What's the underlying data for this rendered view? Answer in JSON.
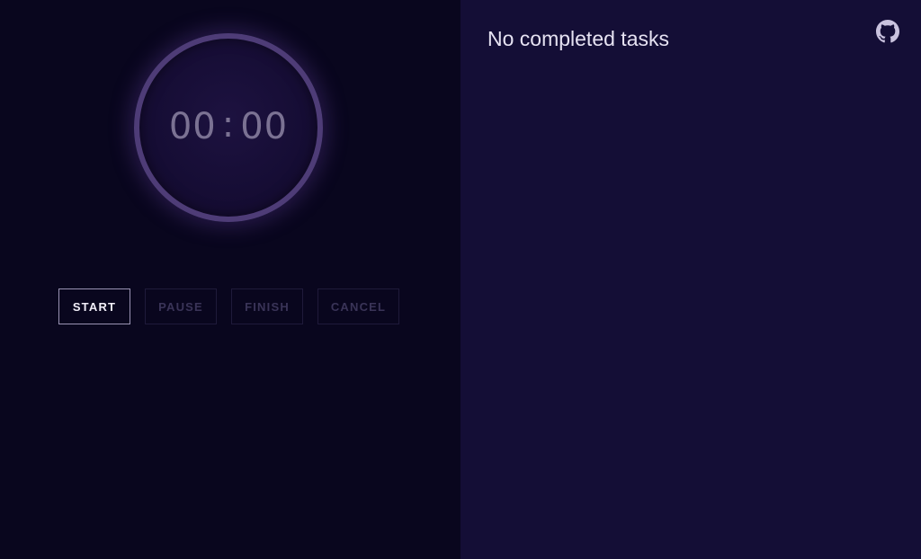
{
  "timer": {
    "minutes": "00",
    "separator": ":",
    "seconds": "00"
  },
  "controls": {
    "start_label": "START",
    "pause_label": "PAUSE",
    "finish_label": "FINISH",
    "cancel_label": "CANCEL"
  },
  "tasks": {
    "empty_message": "No completed tasks"
  },
  "header": {
    "github_icon": "github-icon"
  },
  "colors": {
    "left_background": "#09061e",
    "right_background": "#140e36",
    "dial_ring": "#4e3c77",
    "active_button_border": "#9a93b4",
    "disabled_text": "#3a3458"
  }
}
